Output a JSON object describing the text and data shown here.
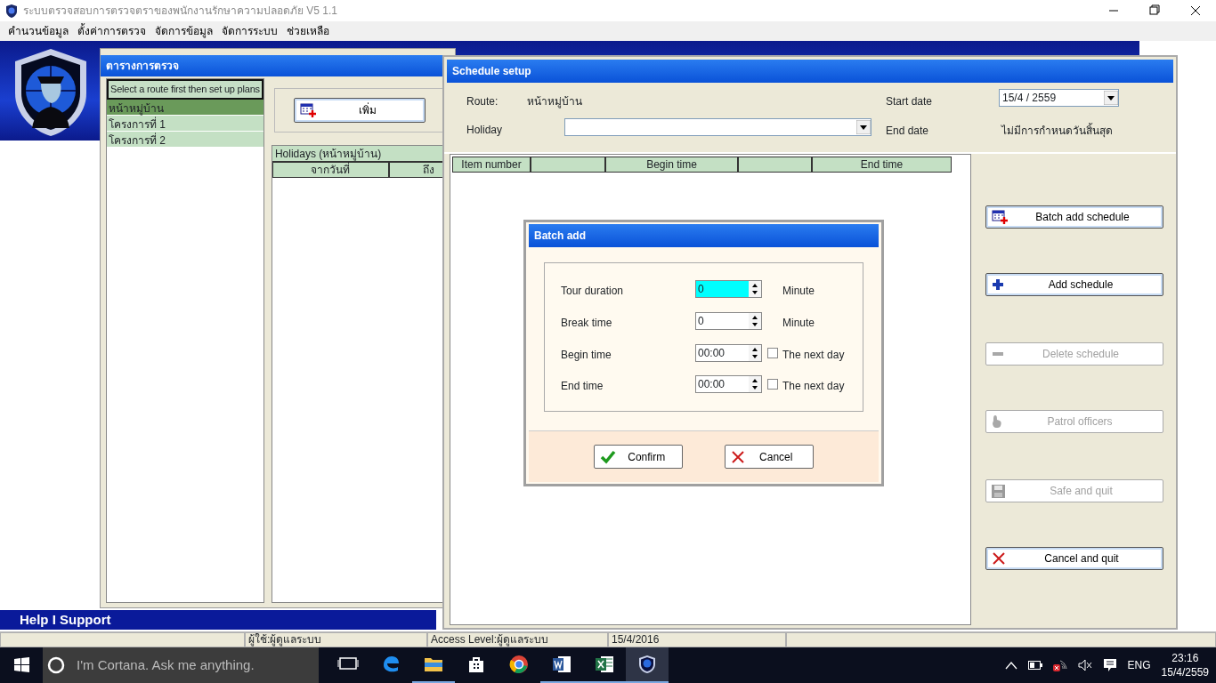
{
  "window": {
    "title": "ระบบตรวจสอบการตรวจตราของพนักงานรักษาความปลอดภัย V5 1.1"
  },
  "menu": [
    {
      "label": "คำนวนข้อมูล"
    },
    {
      "label": "ตั้งค่าการตรวจ"
    },
    {
      "label": "จัดการข้อมูล"
    },
    {
      "label": "จัดการระบบ"
    },
    {
      "label": "ช่วยเหลือ"
    }
  ],
  "banner": {
    "help_text": "Help I Support"
  },
  "route_window": {
    "title": "ตารางการตรวจ",
    "list_header": "Select a route first then set up plans",
    "routes": [
      {
        "label": "หน้าหมู่บ้าน",
        "selected": true
      },
      {
        "label": "โครงการที่ 1",
        "selected": false
      },
      {
        "label": "โครงการที่ 2",
        "selected": false
      }
    ],
    "add_button": {
      "label": "เพิ่ม",
      "kind": "batch"
    },
    "holidays": {
      "title": "Holidays (หน้าหมู่บ้าน)",
      "columns": [
        "จากวันที่",
        "ถึง"
      ]
    }
  },
  "schedule_setup": {
    "title": "Schedule setup",
    "route_label": "Route:",
    "route_value": "หน้าหมู่บ้าน",
    "holiday_label": "Holiday",
    "start_date_label": "Start date",
    "start_date_value": "15/4 / 2559",
    "end_date_label": "End date",
    "end_date_value": "ไม่มีการกำหนดวันสิ้นสุด",
    "columns": [
      {
        "label": "Item number"
      },
      {},
      {
        "label": "Begin time"
      },
      {},
      {
        "label": "End time"
      }
    ],
    "buttons": [
      {
        "label": "Batch add schedule",
        "kind": "batch",
        "disabled": false
      },
      {
        "label": "Add schedule",
        "kind": "plus",
        "disabled": false
      },
      {
        "label": "Delete schedule",
        "kind": "minus",
        "disabled": true
      },
      {
        "label": "Patrol officers",
        "kind": "hand",
        "disabled": true
      },
      {
        "label": "Safe and quit",
        "kind": "floppy",
        "disabled": true
      },
      {
        "label": "Cancel and quit",
        "kind": "cross",
        "disabled": false
      }
    ]
  },
  "batch_add": {
    "title": "Batch add",
    "fields": [
      {
        "label": "Tour duration",
        "value": "0",
        "focused": true,
        "unit": "Minute"
      },
      {
        "label": "Break time",
        "value": "0",
        "focused": false,
        "unit": "Minute"
      },
      {
        "label": "Begin time",
        "value": "00:00",
        "focused": false,
        "next_day": {
          "label": "The next day",
          "checked": false
        }
      },
      {
        "label": "End time",
        "value": "00:00",
        "focused": false,
        "next_day": {
          "label": "The next day",
          "checked": false
        }
      }
    ],
    "buttons": [
      {
        "label": "Confirm",
        "kind": "check"
      },
      {
        "label": "Cancel",
        "kind": "cross"
      }
    ]
  },
  "status_bar": [
    {
      "text": "ผู้ใช้:ผู้ดูแลระบบ"
    },
    {
      "text": "Access Level:ผู้ดูแลระบบ"
    },
    {
      "text": "15/4/2016"
    }
  ],
  "taskbar": {
    "search_placeholder": "I'm Cortana. Ask me anything.",
    "apps": [
      {
        "kind": "taskview",
        "running": false,
        "selected": false
      },
      {
        "kind": "edge",
        "running": false,
        "selected": false
      },
      {
        "kind": "explorer",
        "running": true,
        "selected": false
      },
      {
        "kind": "store",
        "running": false,
        "selected": false
      },
      {
        "kind": "chrome",
        "running": false,
        "selected": false
      },
      {
        "kind": "word",
        "running": true,
        "selected": false
      },
      {
        "kind": "excel",
        "running": true,
        "selected": false
      },
      {
        "kind": "shield",
        "running": true,
        "selected": true
      }
    ],
    "language": "ENG",
    "time": "23:16",
    "date": "15/4/2559"
  }
}
